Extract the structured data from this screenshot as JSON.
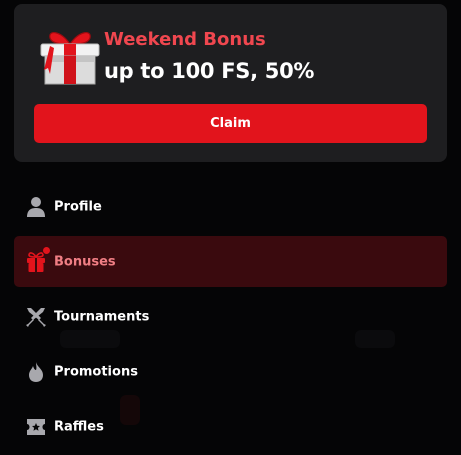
{
  "bonus": {
    "title": "Weekend Bonus",
    "amount": "up to 100 FS, 50%",
    "claim_label": "Claim",
    "gift_icon": "gift-icon"
  },
  "nav": {
    "items": [
      {
        "label": "Profile",
        "icon": "user-icon",
        "active": false
      },
      {
        "label": "Bonuses",
        "icon": "gift-icon",
        "active": true,
        "has_notification": true
      },
      {
        "label": "Tournaments",
        "icon": "crossed-swords-icon",
        "active": false
      },
      {
        "label": "Promotions",
        "icon": "flame-icon",
        "active": false
      },
      {
        "label": "Raffles",
        "icon": "ticket-icon",
        "active": false
      }
    ]
  },
  "colors": {
    "accent": "#e2141c",
    "card_bg": "#1e1e20",
    "active_bg": "#3a0a0e",
    "title_red": "#f0474f",
    "active_label": "#f07e84",
    "icon_gray": "#a8a8ad"
  }
}
